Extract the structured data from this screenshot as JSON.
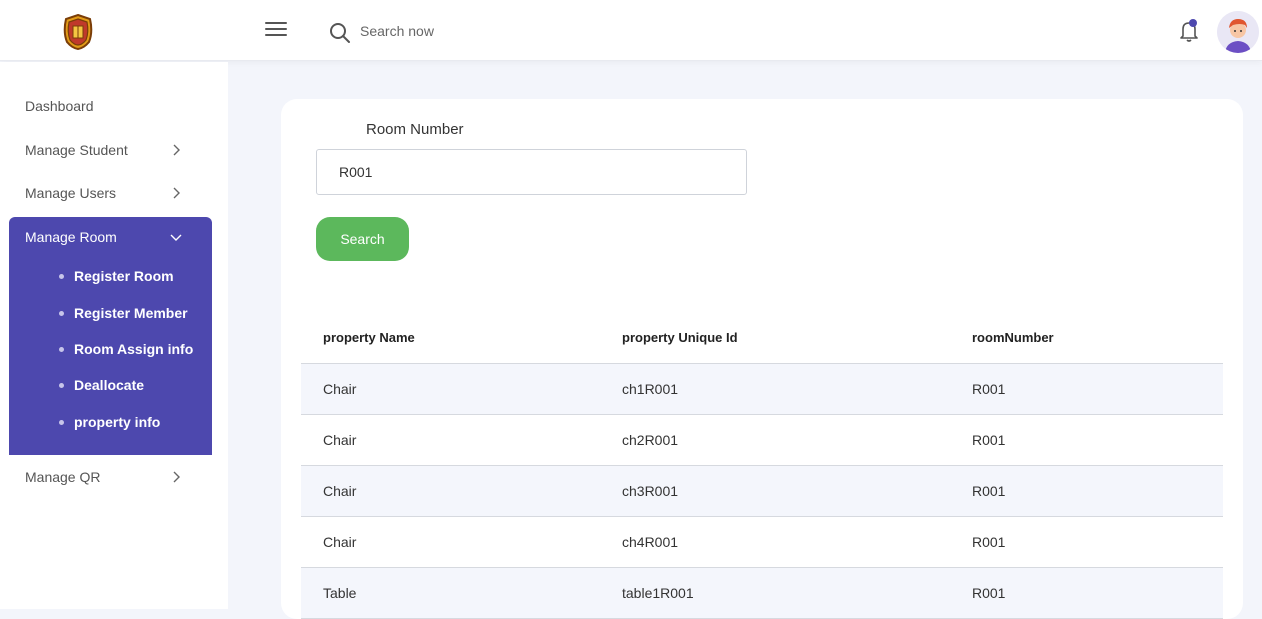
{
  "header": {
    "search_placeholder": "Search now"
  },
  "sidebar": {
    "dashboard": "Dashboard",
    "manage_student": "Manage Student",
    "manage_users": "Manage Users",
    "manage_room": "Manage Room",
    "room_subitems": [
      "Register Room",
      "Register Member",
      "Room Assign info",
      "Deallocate",
      "property info"
    ],
    "manage_qr": "Manage QR",
    "accent_color": "#4d48ae"
  },
  "form": {
    "room_number_label": "Room Number",
    "room_number_value": "R001",
    "search_button": "Search",
    "button_color": "#5cb85c"
  },
  "table": {
    "headers": [
      "property Name",
      "property Unique Id",
      "roomNumber"
    ],
    "rows": [
      [
        "Chair",
        "ch1R001",
        "R001"
      ],
      [
        "Chair",
        "ch2R001",
        "R001"
      ],
      [
        "Chair",
        "ch3R001",
        "R001"
      ],
      [
        "Chair",
        "ch4R001",
        "R001"
      ],
      [
        "Table",
        "table1R001",
        "R001"
      ]
    ]
  }
}
